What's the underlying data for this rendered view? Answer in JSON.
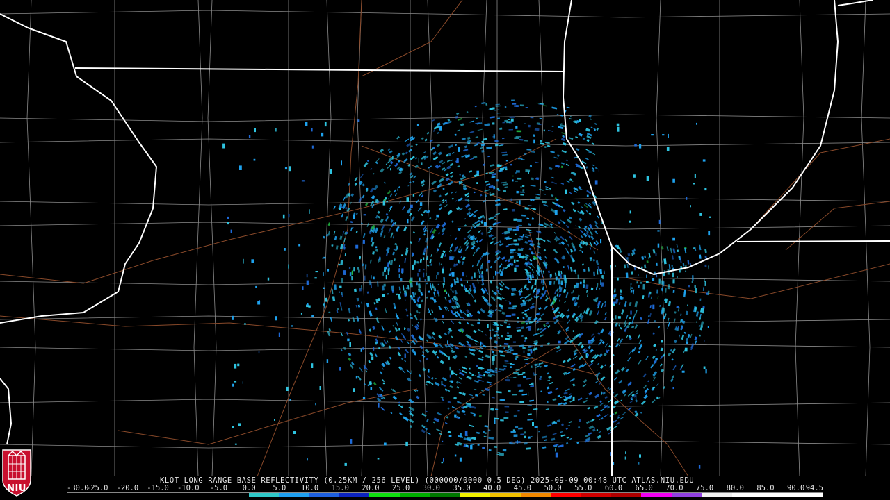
{
  "caption": {
    "product": "KLOT LONG RANGE BASE REFLECTIVITY (0.25KM / 256 LEVEL) (000000/0000 0.5 DEG)",
    "datetime": "2025-09-09 00:48 UTC",
    "site": "ATLAS.NIU.EDU"
  },
  "logo": {
    "text": "NIU",
    "colors": {
      "shield": "#c8102e",
      "tower": "#ffffff"
    }
  },
  "colorscale": {
    "ticks": [
      "-30.0",
      "-25.0",
      "-20.0",
      "-15.0",
      "-10.0",
      "-5.0",
      "0.0",
      "5.0",
      "10.0",
      "15.0",
      "20.0",
      "25.0",
      "30.0",
      "35.0",
      "40.0",
      "45.0",
      "50.0",
      "55.0",
      "60.0",
      "65.0",
      "70.0",
      "75.0",
      "80.0",
      "85.0",
      "90.0",
      "94.5"
    ],
    "min": -30,
    "max": 94.5,
    "colors": [
      "#000000",
      "#000000",
      "#000000",
      "#000000",
      "#000000",
      "#000000",
      "#2fc8c8",
      "#1fa0f0",
      "#1e60e0",
      "#0c24c0",
      "#10e010",
      "#00b000",
      "#007800",
      "#f0f000",
      "#f0c000",
      "#f08800",
      "#ff0000",
      "#d00000",
      "#b00000",
      "#f000f0",
      "#9040e0",
      "#f0f0f0",
      "#ffffff",
      "#ffffff",
      "#ffffff"
    ]
  },
  "map": {
    "colors": {
      "background": "#000000",
      "state_lines": "#ffffff",
      "county_lines": "#8c8c8c",
      "highways": "#8a4a2a",
      "echo_light": "#2ec4e0",
      "echo_mid": "#1ea2ee",
      "echo_dark": "#1e6ad8",
      "echo_green": "#22bb44"
    },
    "radar_site": "KLOT"
  }
}
